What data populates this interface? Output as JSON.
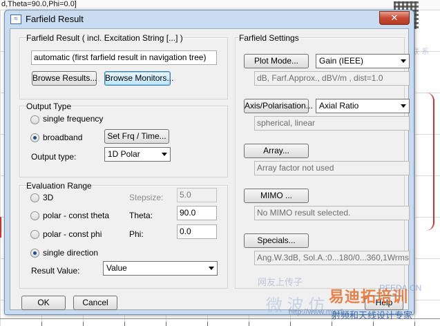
{
  "background": {
    "topline": "d,Theta=90.0,Phi=0.0]"
  },
  "dialog": {
    "title": "Farfield Result",
    "close_label": "✕"
  },
  "farfield_result": {
    "group_label": "Farfield Result ( incl. Excitation String [...] )",
    "name_value": "automatic (first farfield result in navigation tree)",
    "browse_results_label": "Browse Results...",
    "browse_monitors_label": "Browse Monitors..."
  },
  "output_type": {
    "group_label": "Output Type",
    "single_frequency_label": "single frequency",
    "broadband_label": "broadband",
    "selected": "broadband",
    "set_frq_time_label": "Set Frq / Time...",
    "output_type_label": "Output type:",
    "output_type_value": "1D Polar"
  },
  "evaluation_range": {
    "group_label": "Evaluation Range",
    "options": [
      "3D",
      "polar - const theta",
      "polar - const phi",
      "single direction"
    ],
    "selected": "single direction",
    "stepsize_label": "Stepsize:",
    "stepsize_value": "5.0",
    "theta_label": "Theta:",
    "theta_value": "90.0",
    "phi_label": "Phi:",
    "phi_value": "0.0",
    "result_value_label": "Result Value:",
    "result_value": "Value"
  },
  "farfield_settings": {
    "group_label": "Farfield Settings",
    "plot_mode_label": "Plot Mode...",
    "plot_mode_value": "Gain (IEEE)",
    "plot_mode_info": "dB, Farf.Approx., dBV/m , dist=1.0",
    "axis_polarisation_label": "Axis/Polarisation...",
    "axis_polarisation_value": "Axial Ratio",
    "axis_info": "spherical, linear",
    "array_label": "Array...",
    "array_info": "Array factor not used",
    "mimo_label": "MIMO ...",
    "mimo_info": "No MIMO result selected.",
    "specials_label": "Specials...",
    "specials_info": "Ang.W.3dB, Sol.A.:0...180/0...360,1Wrms"
  },
  "footer": {
    "ok_label": "OK",
    "cancel_label": "Cancel",
    "help_label": "Help"
  },
  "watermark": {
    "cn_top": "微 信 联 系",
    "cn_middle": "网友上传子",
    "rfeda": "RFEDA.CN",
    "cn_big": "微 波 仿",
    "logo": "易迪拓培训",
    "logo_sub": "射频和天线设计专家",
    "url": "http://www.mwrf..."
  },
  "colors": {
    "accent": "#3c7fb1",
    "window_frame": "#c9dcef",
    "close_red": "#c74a34",
    "client_bg": "#f0f0f0"
  }
}
